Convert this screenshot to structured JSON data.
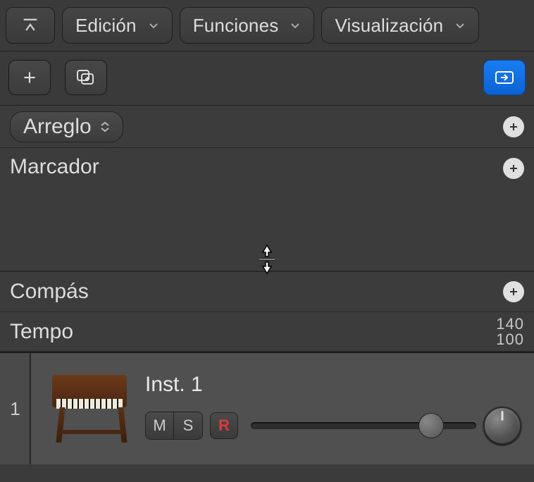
{
  "toolbar": {
    "edit_label": "Edición",
    "functions_label": "Funciones",
    "view_label": "Visualización"
  },
  "global_tracks": {
    "arrangement_label": "Arreglo",
    "marker_label": "Marcador",
    "signature_label": "Compás",
    "tempo_label": "Tempo",
    "tempo_high": "140",
    "tempo_low": "100"
  },
  "track": {
    "number": "1",
    "name": "Inst. 1",
    "mute_label": "M",
    "solo_label": "S",
    "record_label": "R"
  }
}
